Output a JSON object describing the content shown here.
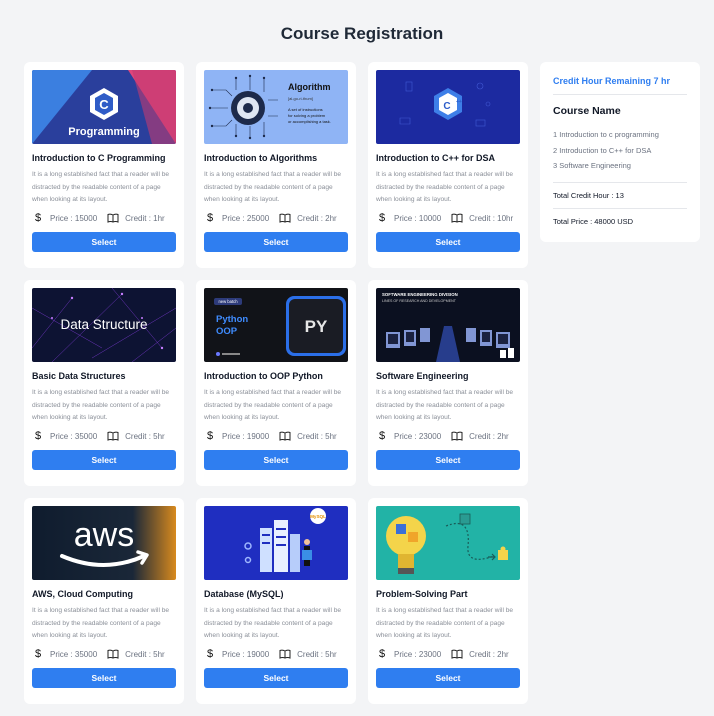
{
  "page": {
    "title": "Course Registration"
  },
  "courses": [
    {
      "thumb": "Programming",
      "title": "Introduction to C Programming",
      "desc": "It is a long established fact that a reader will be distracted by the readable content of a page when looking at its layout.",
      "price": "Price : 15000",
      "credit": "Credit : 1hr",
      "button": "Select"
    },
    {
      "thumb": "Algorithm",
      "thumb_sub": "[al-go-ri-thum]",
      "thumb_desc": "A set of instructions for solving a problem or accomplishing a task.",
      "title": "Introduction to Algorithms",
      "desc": "It is a long established fact that a reader will be distracted by the readable content of a page when looking at its layout.",
      "price": "Price : 25000",
      "credit": "Credit : 2hr",
      "button": "Select"
    },
    {
      "thumb": "C++",
      "title": "Introduction to C++ for DSA",
      "desc": "It is a long established fact that a reader will be distracted by the readable content of a page when looking at its layout.",
      "price": "Price : 10000",
      "credit": "Credit : 10hr",
      "button": "Select"
    },
    {
      "thumb": "Data Structure",
      "title": "Basic Data Structures",
      "desc": "It is a long established fact that a reader will be distracted by the readable content of a page when looking at its layout.",
      "price": "Price : 35000",
      "credit": "Credit : 5hr",
      "button": "Select"
    },
    {
      "thumb": "Python OOP",
      "thumb_tag": "new batch",
      "thumb_big": "PY",
      "title": "Introduction to OOP Python",
      "desc": "It is a long established fact that a reader will be distracted by the readable content of a page when looking at its layout.",
      "price": "Price : 19000",
      "credit": "Credit : 5hr",
      "button": "Select"
    },
    {
      "thumb": "SOFTWARE ENGINEERING DIVISION",
      "thumb_sub": "LINES OF RESEARCH AND DEVELOPMENT",
      "title": "Software Engineering",
      "desc": "It is a long established fact that a reader will be distracted by the readable content of a page when looking at its layout.",
      "price": "Price : 23000",
      "credit": "Credit : 2hr",
      "button": "Select"
    },
    {
      "thumb": "aws",
      "title": "AWS, Cloud Computing",
      "desc": "It is a long established fact that a reader will be distracted by the readable content of a page when looking at its layout.",
      "price": "Price : 35000",
      "credit": "Credit : 5hr",
      "button": "Select"
    },
    {
      "thumb": "MySQL",
      "title": "Database (MySQL)",
      "desc": "It is a long established fact that a reader will be distracted by the readable content of a page when looking at its layout.",
      "price": "Price : 19000",
      "credit": "Credit : 5hr",
      "button": "Select"
    },
    {
      "thumb": "puzzle-bulb",
      "title": "Problem-Solving Part",
      "desc": "It is a long established fact that a reader will be distracted by the readable content of a page when looking at its layout.",
      "price": "Price : 23000",
      "credit": "Credit : 2hr",
      "button": "Select"
    }
  ],
  "sidebar": {
    "credit_remaining": "Credit Hour Remaining 7 hr",
    "course_name_heading": "Course Name",
    "items": [
      "1 Introduction to c programming",
      "2 Introduction to C++ for DSA",
      "3 Software Engineering"
    ],
    "total_credit": "Total Credit Hour : 13",
    "total_price": "Total Price : 48000 USD"
  },
  "colors": {
    "accent": "#2f7ef0",
    "background": "#f3f4f6"
  },
  "icons": {
    "price": "dollar-icon",
    "credit": "book-icon"
  }
}
